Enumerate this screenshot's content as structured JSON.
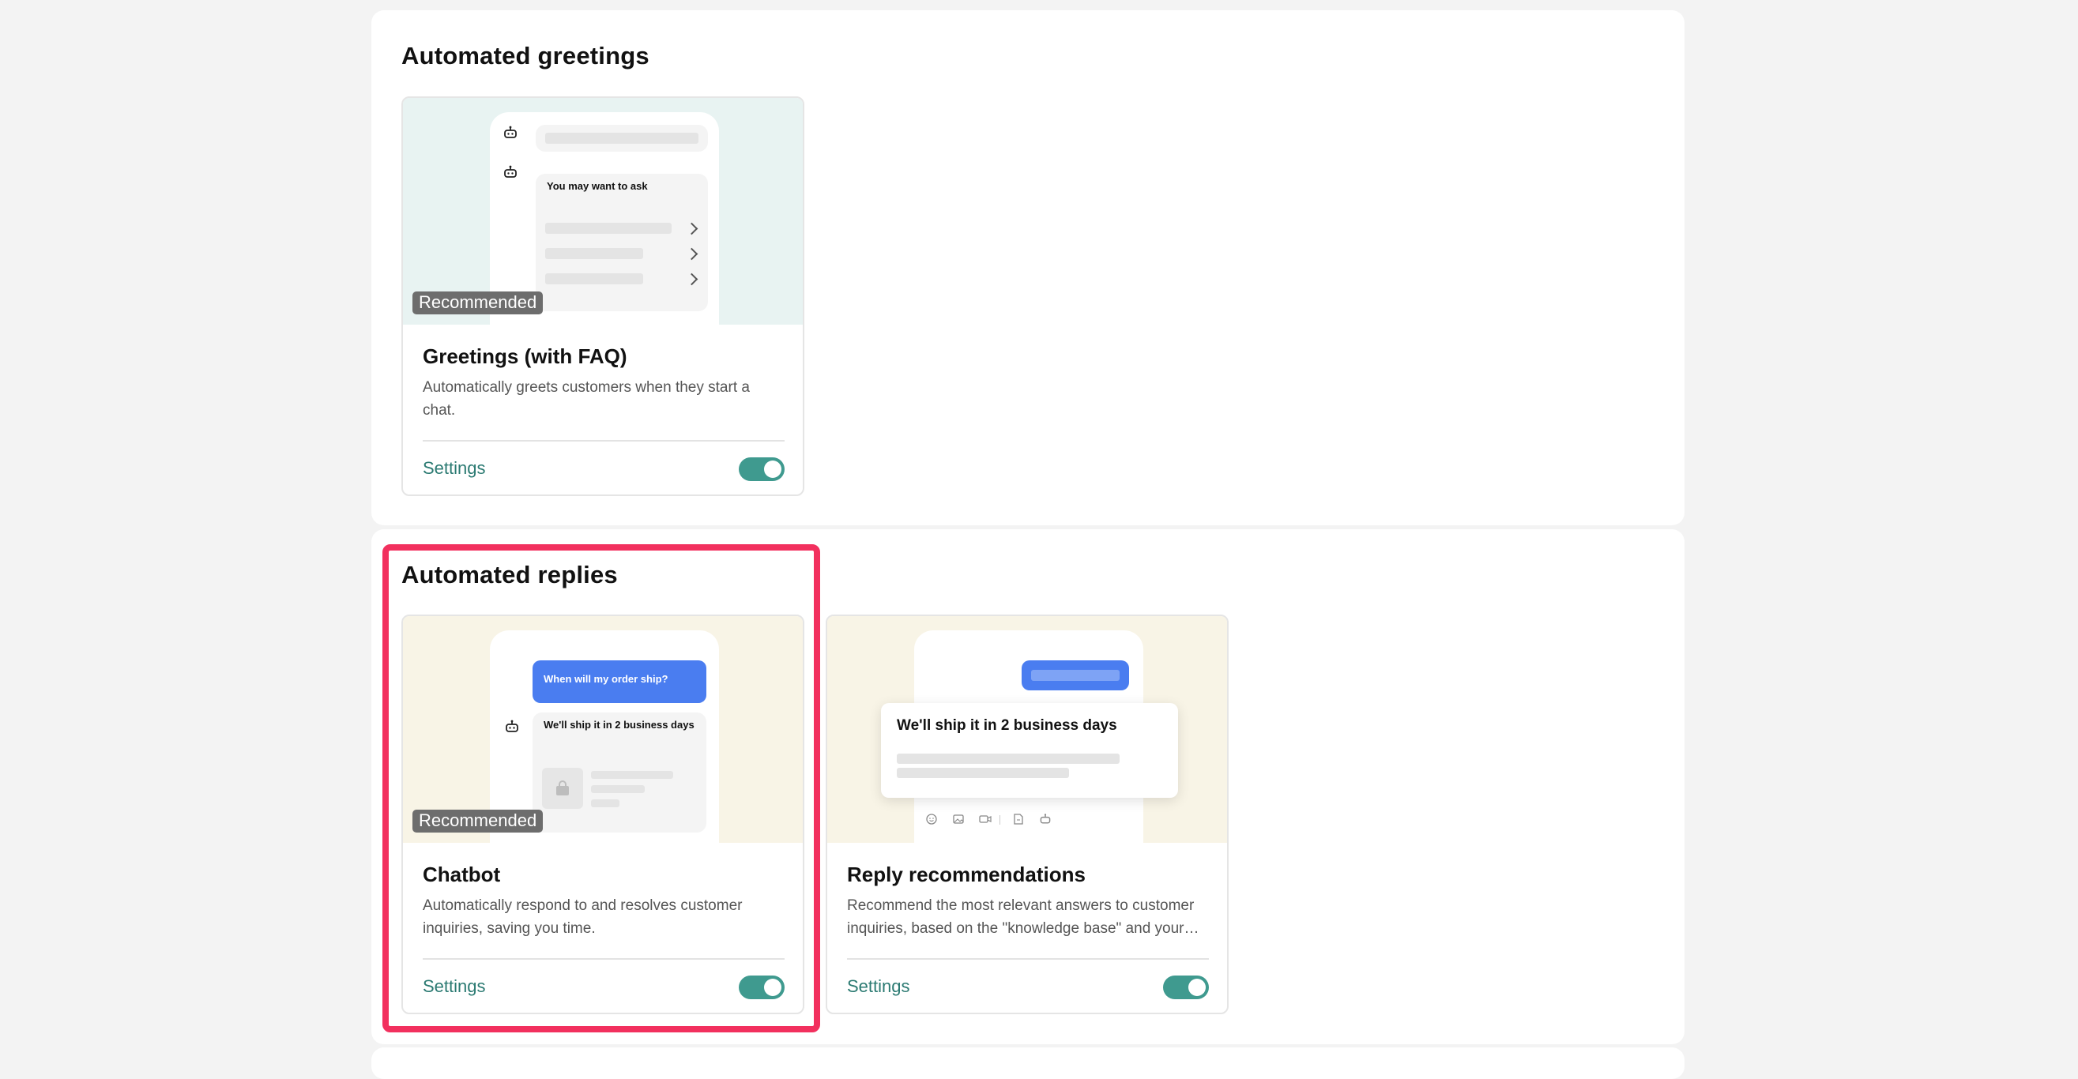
{
  "sections": {
    "greetings": {
      "title": "Automated greetings",
      "cards": [
        {
          "preview_text": "You may want to ask",
          "badge": "Recommended",
          "title": "Greetings (with FAQ)",
          "description": "Automatically greets customers when they start a chat.",
          "settings_label": "Settings",
          "enabled": true
        }
      ]
    },
    "replies": {
      "title": "Automated replies",
      "cards": [
        {
          "preview_question": "When will my order ship?",
          "preview_answer": "We'll ship it in 2 business days",
          "badge": "Recommended",
          "title": "Chatbot",
          "description": "Automatically respond to and resolves customer inquiries, saving you time.",
          "settings_label": "Settings",
          "enabled": true
        },
        {
          "preview_answer": "We'll ship it in 2 business days",
          "title": "Reply recommendations",
          "description": "Recommend the most relevant answers to customer inquiries, based on the \"knowledge base\" and your chat history.",
          "settings_label": "Settings",
          "enabled": true
        }
      ]
    }
  },
  "colors": {
    "accent_teal": "#3f9a8f",
    "link_teal": "#2b7a72",
    "highlight_red": "#f2305e",
    "chat_blue": "#4a7df0",
    "badge_gray": "#6d6d6d"
  },
  "icons": [
    "robot-icon",
    "chevron-right-icon",
    "shopping-bag-icon",
    "emoji-icon",
    "image-icon",
    "video-icon",
    "file-icon"
  ]
}
